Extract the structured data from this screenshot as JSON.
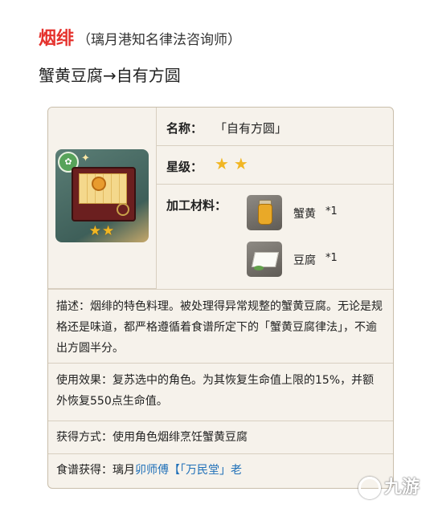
{
  "header": {
    "character_name": "烟绯",
    "character_title": "（璃月港知名律法咨询师）",
    "subtitle": "蟹黄豆腐→自有方圆"
  },
  "item": {
    "name_label": "名称：",
    "name_value": "「自有方圆」",
    "rarity_label": "星级：",
    "rarity_stars": "★★",
    "rarity_count": 2,
    "materials_label": "加工材料：",
    "materials": [
      {
        "name": "蟹黄",
        "qty": "*1",
        "icon": "crab-roe-jar-icon"
      },
      {
        "name": "豆腐",
        "qty": "*1",
        "icon": "tofu-icon"
      }
    ],
    "tile_stars": "★★",
    "tile_badge_icon": "food-type-badge-icon"
  },
  "description": "描述：烟绯的特色料理。被处理得异常规整的蟹黄豆腐。无论是规格还是味道，都严格遵循着食谱所定下的「蟹黄豆腐律法」，不逾出方圆半分。",
  "effect": "使用效果：复苏选中的角色。为其恢复生命值上限的15%，并额外恢复550点生命值。",
  "obtain": "获得方式：使用角色烟绯烹饪蟹黄豆腐",
  "recipe": {
    "label": "食谱获得：璃月",
    "link": "卯师傅【「万民堂」老"
  },
  "watermark": "九游",
  "colors": {
    "accent_red": "#e5322d",
    "star_gold": "#f1b623",
    "link_blue": "#1e6fb8",
    "card_bg": "#f6f2eb"
  }
}
